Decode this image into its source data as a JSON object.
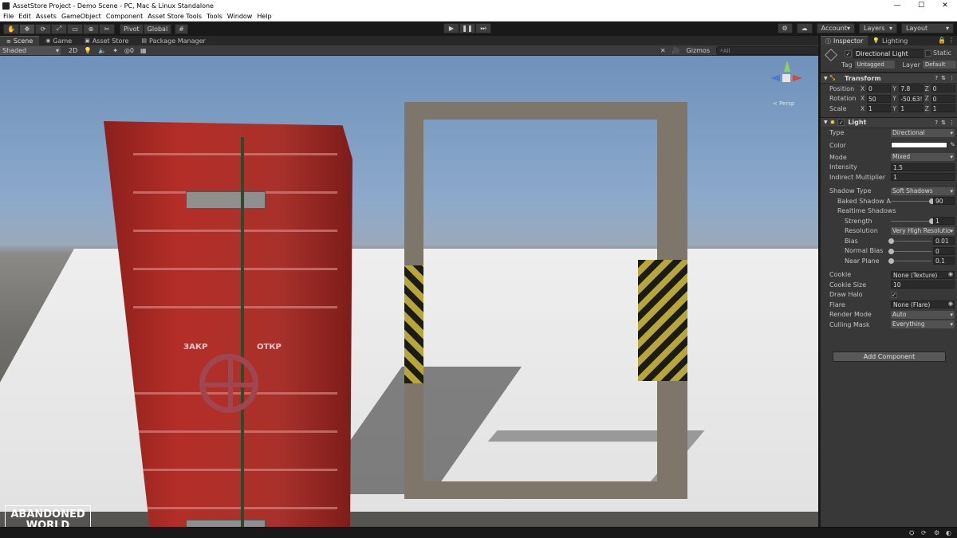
{
  "window": {
    "title": "AssetStore Project - Demo Scene - PC, Mac & Linux Standalone",
    "controls": [
      "—",
      "☐",
      "✕"
    ]
  },
  "menu": [
    "File",
    "Edit",
    "Assets",
    "GameObject",
    "Component",
    "Asset Store Tools",
    "Tools",
    "Window",
    "Help"
  ],
  "toolbar": {
    "tools": [
      "✋",
      "✥",
      "⟳",
      "⤢",
      "▭",
      "⊕",
      "✂"
    ],
    "pivot": "Pivot",
    "global": "Global",
    "grid": "#",
    "play": "▶",
    "pause": "❚❚",
    "step": "⏭",
    "account": "Account",
    "layers": "Layers",
    "layout": "Layout",
    "dd_arrow": "▾"
  },
  "scene": {
    "tabs": [
      {
        "icon": "≡",
        "label": "Scene"
      },
      {
        "icon": "◉",
        "label": "Game"
      },
      {
        "icon": "▣",
        "label": "Asset Store"
      },
      {
        "icon": "▤",
        "label": "Package Manager"
      }
    ],
    "shading": "Shaded",
    "mode2d": "2D",
    "light": "💡",
    "audio": "🔈",
    "fx": "✦",
    "hidden": "◎0",
    "grid": "▦",
    "tools": "✕",
    "camera": "🎥",
    "gizmos": "Gizmos",
    "search_placeholder": "All",
    "persp": "< Persp",
    "door_label_close": "ЗАКР",
    "door_label_open": "ОТКР",
    "logo_line1": "ABANDONED",
    "logo_line2": "WORLD"
  },
  "inspector": {
    "tab_inspector": "Inspector",
    "tab_lighting": "Lighting",
    "object_name": "Directional Light",
    "static": "Static",
    "tag_label": "Tag",
    "tag_value": "Untagged",
    "layer_label": "Layer",
    "layer_value": "Default",
    "check": "✓",
    "help": "?",
    "preset": "⇅",
    "more": "⋮",
    "transform": {
      "title": "Transform",
      "position": {
        "label": "Position",
        "x": "0",
        "y": "7.8",
        "z": "0"
      },
      "rotation": {
        "label": "Rotation",
        "x": "50",
        "y": "-50.63!",
        "z": "0"
      },
      "scale": {
        "label": "Scale",
        "x": "1",
        "y": "1",
        "z": "1"
      }
    },
    "light": {
      "title": "Light",
      "type": {
        "label": "Type",
        "value": "Directional"
      },
      "color": {
        "label": "Color",
        "hex": "#ffffff"
      },
      "mode": {
        "label": "Mode",
        "value": "Mixed"
      },
      "intensity": {
        "label": "Intensity",
        "value": "1.5"
      },
      "indirect": {
        "label": "Indirect Multiplier",
        "value": "1"
      },
      "shadow_type": {
        "label": "Shadow Type",
        "value": "Soft Shadows"
      },
      "baked_angle": {
        "label": "Baked Shadow An",
        "value": "90",
        "fraction": 1.0
      },
      "realtime": "Realtime Shadows",
      "strength": {
        "label": "Strength",
        "value": "1",
        "fraction": 1.0
      },
      "resolution": {
        "label": "Resolution",
        "value": "Very High Resolutio"
      },
      "bias": {
        "label": "Bias",
        "value": "0.01",
        "fraction": 0.0
      },
      "normal_bias": {
        "label": "Normal Bias",
        "value": "0",
        "fraction": 0.0
      },
      "near_plane": {
        "label": "Near Plane",
        "value": "0.1",
        "fraction": 0.0
      },
      "cookie": {
        "label": "Cookie",
        "value": "None (Texture)"
      },
      "cookie_size": {
        "label": "Cookie Size",
        "value": "10"
      },
      "draw_halo": {
        "label": "Draw Halo",
        "value": "✓"
      },
      "flare": {
        "label": "Flare",
        "value": "None (Flare)"
      },
      "render_mode": {
        "label": "Render Mode",
        "value": "Auto"
      },
      "culling_mask": {
        "label": "Culling Mask",
        "value": "Everything"
      }
    },
    "add_component": "Add Component"
  },
  "status": {
    "icons": [
      "⛭",
      "⟳",
      "⚙",
      "◐"
    ]
  }
}
